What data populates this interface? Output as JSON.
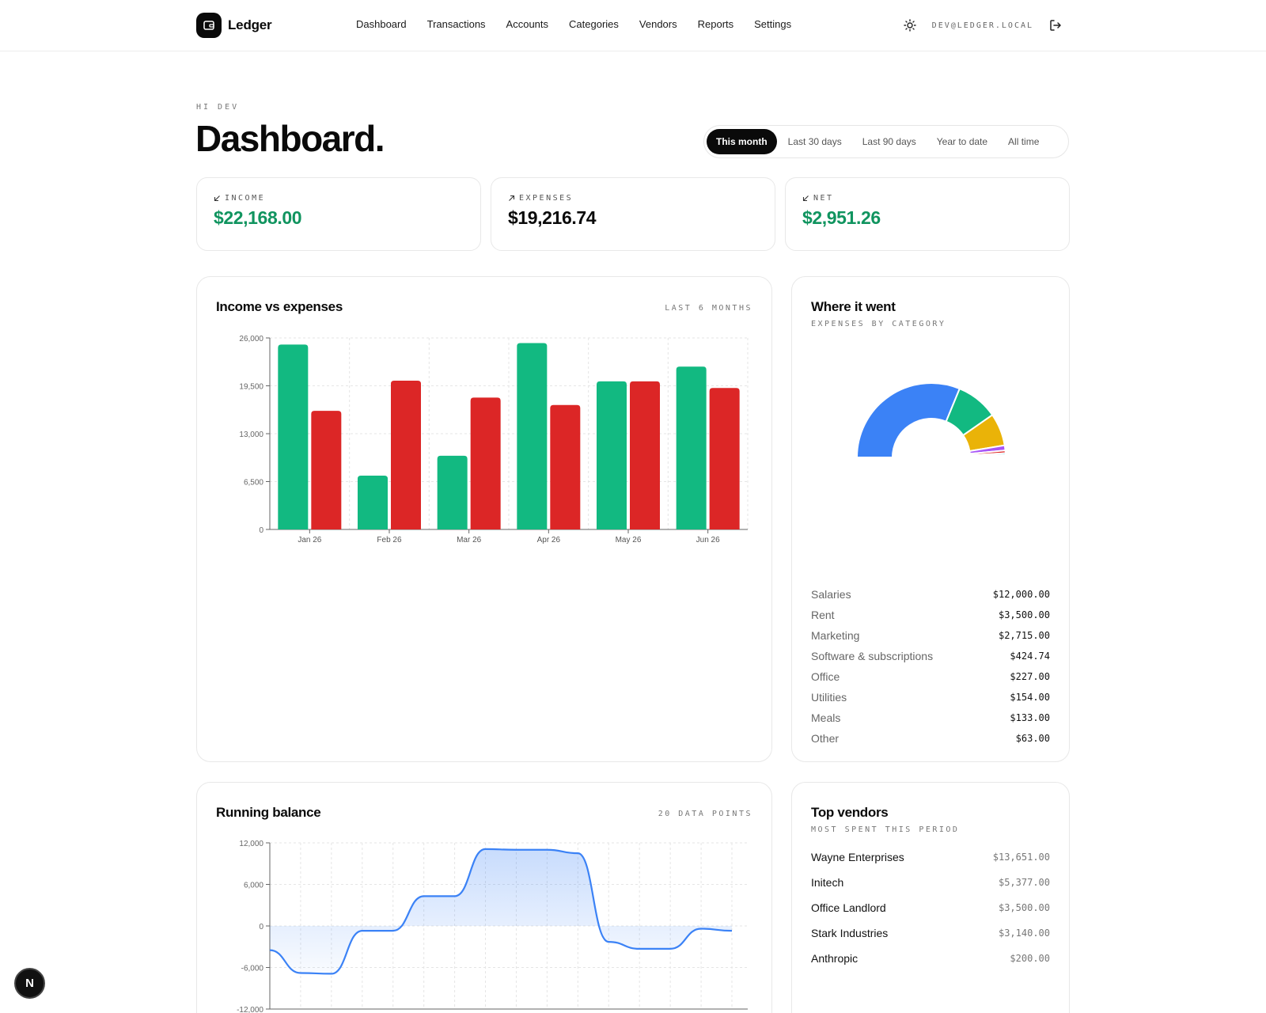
{
  "app": {
    "name": "Ledger"
  },
  "nav": {
    "items": [
      "Dashboard",
      "Transactions",
      "Accounts",
      "Categories",
      "Vendors",
      "Reports",
      "Settings"
    ],
    "user_email": "DEV@LEDGER.LOCAL",
    "icons": [
      "sun-icon",
      "logout-icon"
    ]
  },
  "header": {
    "greeting": "HI DEV",
    "title": "Dashboard."
  },
  "range_tabs": {
    "items": [
      "This month",
      "Last 30 days",
      "Last 90 days",
      "Year to date",
      "All time"
    ],
    "active": "This month"
  },
  "stats": {
    "income": {
      "label": "INCOME",
      "value": "$22,168.00"
    },
    "expenses": {
      "label": "EXPENSES",
      "value": "$19,216.74"
    },
    "net": {
      "label": "NET",
      "value": "$2,951.26"
    }
  },
  "income_expenses": {
    "title": "Income vs expenses",
    "meta": "LAST 6 MONTHS"
  },
  "where": {
    "title": "Where it went",
    "subtitle": "EXPENSES BY CATEGORY"
  },
  "categories": [
    {
      "name": "Salaries",
      "amount": "$12,000.00"
    },
    {
      "name": "Rent",
      "amount": "$3,500.00"
    },
    {
      "name": "Marketing",
      "amount": "$2,715.00"
    },
    {
      "name": "Software & subscriptions",
      "amount": "$424.74"
    },
    {
      "name": "Office",
      "amount": "$227.00"
    },
    {
      "name": "Utilities",
      "amount": "$154.00"
    },
    {
      "name": "Meals",
      "amount": "$133.00"
    },
    {
      "name": "Other",
      "amount": "$63.00"
    }
  ],
  "balance": {
    "title": "Running balance",
    "meta": "20 DATA POINTS"
  },
  "vendors": {
    "title": "Top vendors",
    "subtitle": "MOST SPENT THIS PERIOD",
    "items": [
      {
        "name": "Wayne Enterprises",
        "amount": "$13,651.00"
      },
      {
        "name": "Initech",
        "amount": "$5,377.00"
      },
      {
        "name": "Office Landlord",
        "amount": "$3,500.00"
      },
      {
        "name": "Stark Industries",
        "amount": "$3,140.00"
      },
      {
        "name": "Anthropic",
        "amount": "$200.00"
      }
    ]
  },
  "colors": {
    "income": "#12b981",
    "expense": "#dc2626",
    "balance": "#3b82f6",
    "accent": "#0a0a0a"
  },
  "chart_data": [
    {
      "type": "bar",
      "categories": [
        "Jan 26",
        "Feb 26",
        "Mar 26",
        "Apr 26",
        "May 26",
        "Jun 26"
      ],
      "series": [
        {
          "values": [
            25100,
            7300,
            10000,
            25300,
            20100,
            22100
          ]
        },
        {
          "values": [
            16100,
            20200,
            17900,
            16900,
            20100,
            19200
          ]
        }
      ],
      "ylim": [
        0,
        26000
      ],
      "yticks": [
        "0",
        "6,500",
        "13,000",
        "19,500",
        "26,000"
      ],
      "ytick_values": [
        0,
        6500,
        13000,
        19500,
        26000
      ],
      "grid": true
    },
    {
      "type": "pie",
      "labels": [
        "Salaries",
        "Rent",
        "Marketing",
        "Software & subscriptions",
        "Office",
        "Utilities",
        "Meals",
        "Other"
      ],
      "values": [
        12000,
        3500,
        2715,
        424.74,
        227,
        154,
        133,
        63
      ],
      "colors": [
        "#3b82f6",
        "#12b981",
        "#eab308",
        "#a855f7",
        "#dc2626",
        "#0ea5e9",
        "#f97316",
        "#94a3b8"
      ]
    },
    {
      "type": "area",
      "values": [
        -3500,
        -6800,
        -6900,
        -700,
        -700,
        4300,
        4300,
        11100,
        11000,
        11000,
        10500,
        -2300,
        -3300,
        -3300,
        -400,
        -700
      ],
      "ylim": [
        -12000,
        12000
      ],
      "yticks": [
        "-12,000",
        "-6,000",
        "0",
        "6,000",
        "12,000"
      ],
      "ytick_values": [
        -12000,
        -6000,
        0,
        6000,
        12000
      ],
      "grid": true
    }
  ]
}
